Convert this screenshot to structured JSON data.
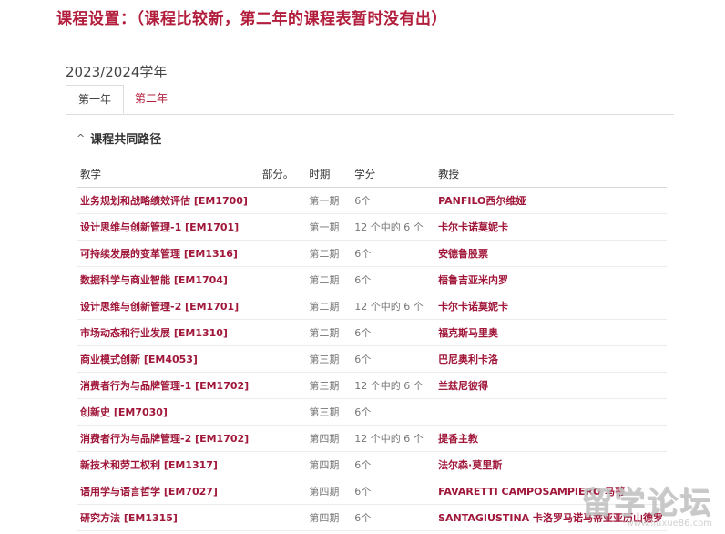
{
  "heading": "课程设置：（课程比较新，第二年的课程表暂时没有出）",
  "academic_year": "2023/2024学年",
  "tabs": [
    {
      "label": "第一年",
      "active": true
    },
    {
      "label": "第二年",
      "active": false
    }
  ],
  "section": {
    "caret_icon": "chevron-up-icon",
    "title": "课程共同路径"
  },
  "table": {
    "headers": {
      "course": "教学",
      "part": "部分。",
      "period": "时期",
      "credits": "学分",
      "professor": "教授"
    },
    "rows": [
      {
        "course": "业务规划和战略绩效评估 [EM1700]",
        "part": "",
        "period": "第一期",
        "credits": "6个",
        "professor": "PANFILO西尔维娅"
      },
      {
        "course": "设计思维与创新管理-1 [EM1701]",
        "part": "",
        "period": "第一期",
        "credits": "12 个中的 6 个",
        "professor": "卡尔卡诺莫妮卡"
      },
      {
        "course": "可持续发展的变革管理 [EM1316]",
        "part": "",
        "period": "第二期",
        "credits": "6个",
        "professor": "安德鲁股票"
      },
      {
        "course": "数据科学与商业智能 [EM1704]",
        "part": "",
        "period": "第二期",
        "credits": "6个",
        "professor": "梧鲁吉亚米内罗"
      },
      {
        "course": "设计思维与创新管理-2 [EM1701]",
        "part": "",
        "period": "第二期",
        "credits": "12 个中的 6 个",
        "professor": "卡尔卡诺莫妮卡"
      },
      {
        "course": "市场动态和行业发展 [EM1310]",
        "part": "",
        "period": "第二期",
        "credits": "6个",
        "professor": "福克斯马里奥"
      },
      {
        "course": "商业模式创新 [EM4053]",
        "part": "",
        "period": "第三期",
        "credits": "6个",
        "professor": "巴尼奥利卡洛"
      },
      {
        "course": "消费者行为与品牌管理-1 [EM1702]",
        "part": "",
        "period": "第三期",
        "credits": "12 个中的 6 个",
        "professor": "兰兹尼彼得"
      },
      {
        "course": "创新史 [EM7030]",
        "part": "",
        "period": "第三期",
        "credits": "6个",
        "professor": ""
      },
      {
        "course": "消费者行为与品牌管理-2 [EM1702]",
        "part": "",
        "period": "第四期",
        "credits": "12 个中的 6 个",
        "professor": "提香主教"
      },
      {
        "course": "新技术和劳工权利 [EM1317]",
        "part": "",
        "period": "第四期",
        "credits": "6个",
        "professor": "法尔森·莫里斯"
      },
      {
        "course": "语用学与语言哲学 [EM7027]",
        "part": "",
        "period": "第四期",
        "credits": "6个",
        "professor": "FAVARETTI CAMPOSAMPIERO 马蒂"
      },
      {
        "course": "研究方法 [EM1315]",
        "part": "",
        "period": "第四期",
        "credits": "6个",
        "professor": "SANTAGIUSTINA 卡洛罗马诺马蒂亚亚历山德罗"
      }
    ]
  },
  "watermark": {
    "main": "留学论坛",
    "sub": "www.liuxue86.com"
  }
}
